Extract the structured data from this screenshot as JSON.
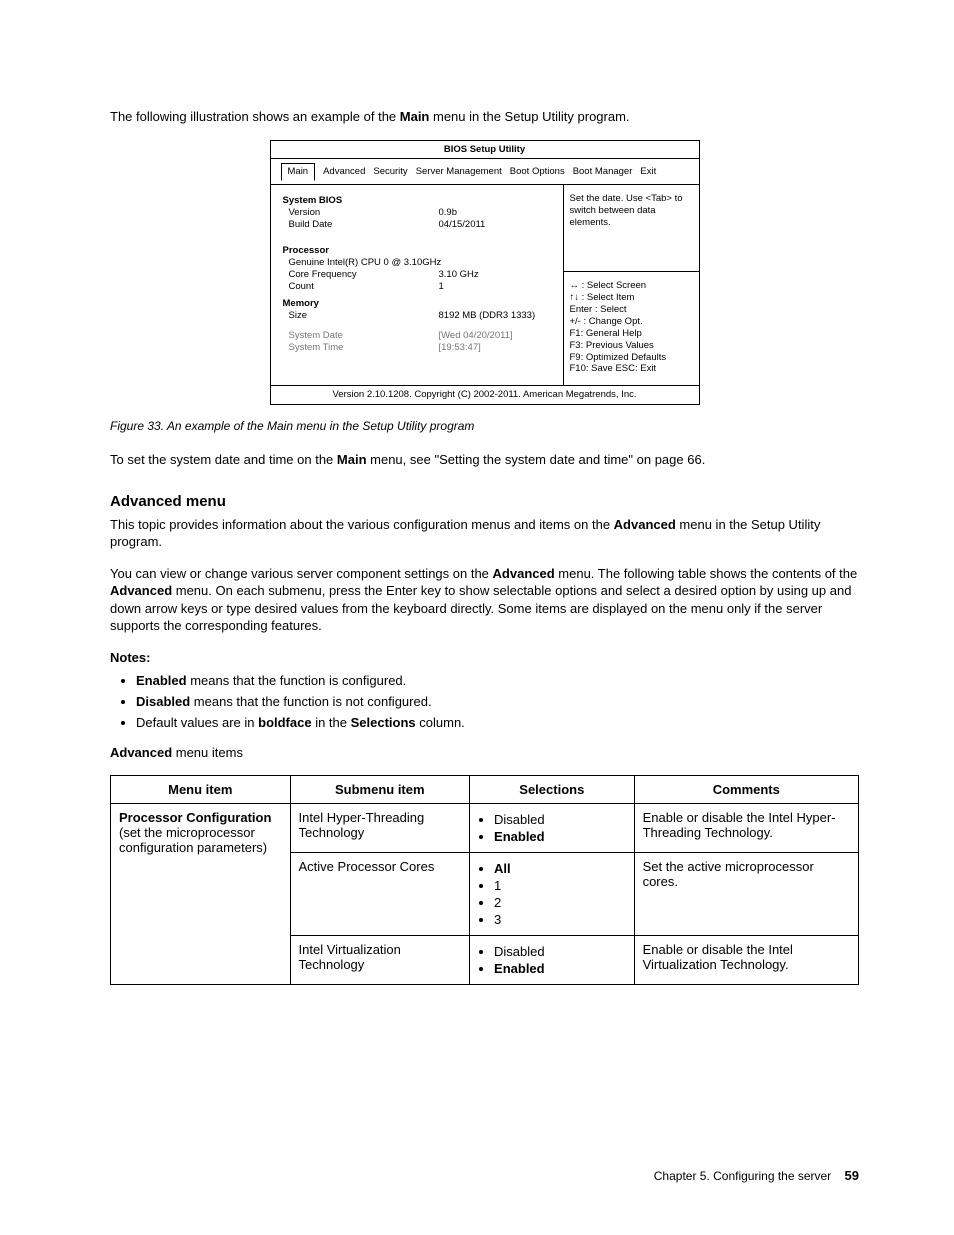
{
  "intro_before": "The following illustration shows an example of the ",
  "intro_bold": "Main",
  "intro_after": " menu in the Setup Utility program.",
  "bios": {
    "title": "BIOS Setup Utility",
    "tabs": [
      "Main",
      "Advanced",
      "Security",
      "Server Management",
      "Boot Options",
      "Boot Manager",
      "Exit"
    ],
    "left": {
      "system_bios_label": "System BIOS",
      "version_label": "Version",
      "version_value": "0.9b",
      "build_date_label": "Build Date",
      "build_date_value": "04/15/2011",
      "processor_label": "Processor",
      "cpu_line": "Genuine Intel(R) CPU 0 @ 3.10GHz",
      "core_freq_label": "Core Frequency",
      "core_freq_value": "3.10 GHz",
      "count_label": "Count",
      "count_value": "1",
      "memory_label": "Memory",
      "size_label": "Size",
      "size_value": "8192 MB (DDR3 1333)",
      "sysdate_label": "System Date",
      "sysdate_value": "[Wed 04/20/2011]",
      "systime_label": "System Time",
      "systime_value": "[19:53:47]"
    },
    "help_top": "Set the date. Use <Tab> to switch between data elements.",
    "help_lines": [
      "↔ : Select Screen",
      "↑↓ : Select Item",
      "Enter : Select",
      "+/- : Change Opt.",
      "F1: General Help",
      "F3: Previous Values",
      "F9: Optimized Defaults",
      "F10: Save   ESC: Exit"
    ],
    "footer": "Version 2.10.1208.  Copyright (C) 2002-2011.  American Megatrends, Inc."
  },
  "caption_prefix": "Figure 33.  ",
  "caption_text": "An example of the Main menu in the Setup Utility program",
  "set_dt_before": "To set the system date and time on the ",
  "set_dt_bold": "Main",
  "set_dt_after": " menu, see \"Setting the system date and time\" on page 66.",
  "adv_heading": "Advanced menu",
  "adv_p1_before": "This topic provides information about the various configuration menus and items on the ",
  "adv_p1_bold": "Advanced",
  "adv_p1_after": " menu in the Setup Utility program.",
  "adv_p2_a": "You can view or change various server component settings on the ",
  "adv_p2_b": "Advanced",
  "adv_p2_c": " menu.  The following table shows the contents of the ",
  "adv_p2_d": "Advanced",
  "adv_p2_e": " menu.  On each submenu, press the Enter key to show selectable options and select a desired option by using up and down arrow keys or type desired values from the keyboard directly.  Some items are displayed on the menu only if the server supports the corresponding features.",
  "notes_label": "Notes:",
  "notes": {
    "n1_b": "Enabled",
    "n1_t": " means that the function is configured.",
    "n2_b": "Disabled",
    "n2_t": " means that the function is not configured.",
    "n3_a": "Default values are in ",
    "n3_b": "boldface",
    "n3_c": " in the ",
    "n3_d": "Selections",
    "n3_e": " column."
  },
  "adv_items_label_b": "Advanced",
  "adv_items_label_t": " menu items",
  "table": {
    "headers": [
      "Menu item",
      "Submenu item",
      "Selections",
      "Comments"
    ],
    "menu_item_b": "Processor Configuration",
    "menu_item_t": " (set the microprocessor configuration parameters)",
    "rows": [
      {
        "submenu": "Intel Hyper-Threading Technology",
        "selections": [
          {
            "text": "Disabled",
            "bold": false
          },
          {
            "text": "Enabled",
            "bold": true
          }
        ],
        "comment": "Enable or disable the Intel Hyper-Threading Technology."
      },
      {
        "submenu": "Active Processor Cores",
        "selections": [
          {
            "text": "All",
            "bold": true
          },
          {
            "text": "1",
            "bold": false
          },
          {
            "text": "2",
            "bold": false
          },
          {
            "text": "3",
            "bold": false
          }
        ],
        "comment": "Set the active microprocessor cores."
      },
      {
        "submenu": "Intel Virtualization Technology",
        "selections": [
          {
            "text": "Disabled",
            "bold": false
          },
          {
            "text": "Enabled",
            "bold": true
          }
        ],
        "comment": "Enable or disable the Intel Virtualization Technology."
      }
    ]
  },
  "footer_chapter": "Chapter 5.  Configuring the server",
  "footer_page": "59"
}
